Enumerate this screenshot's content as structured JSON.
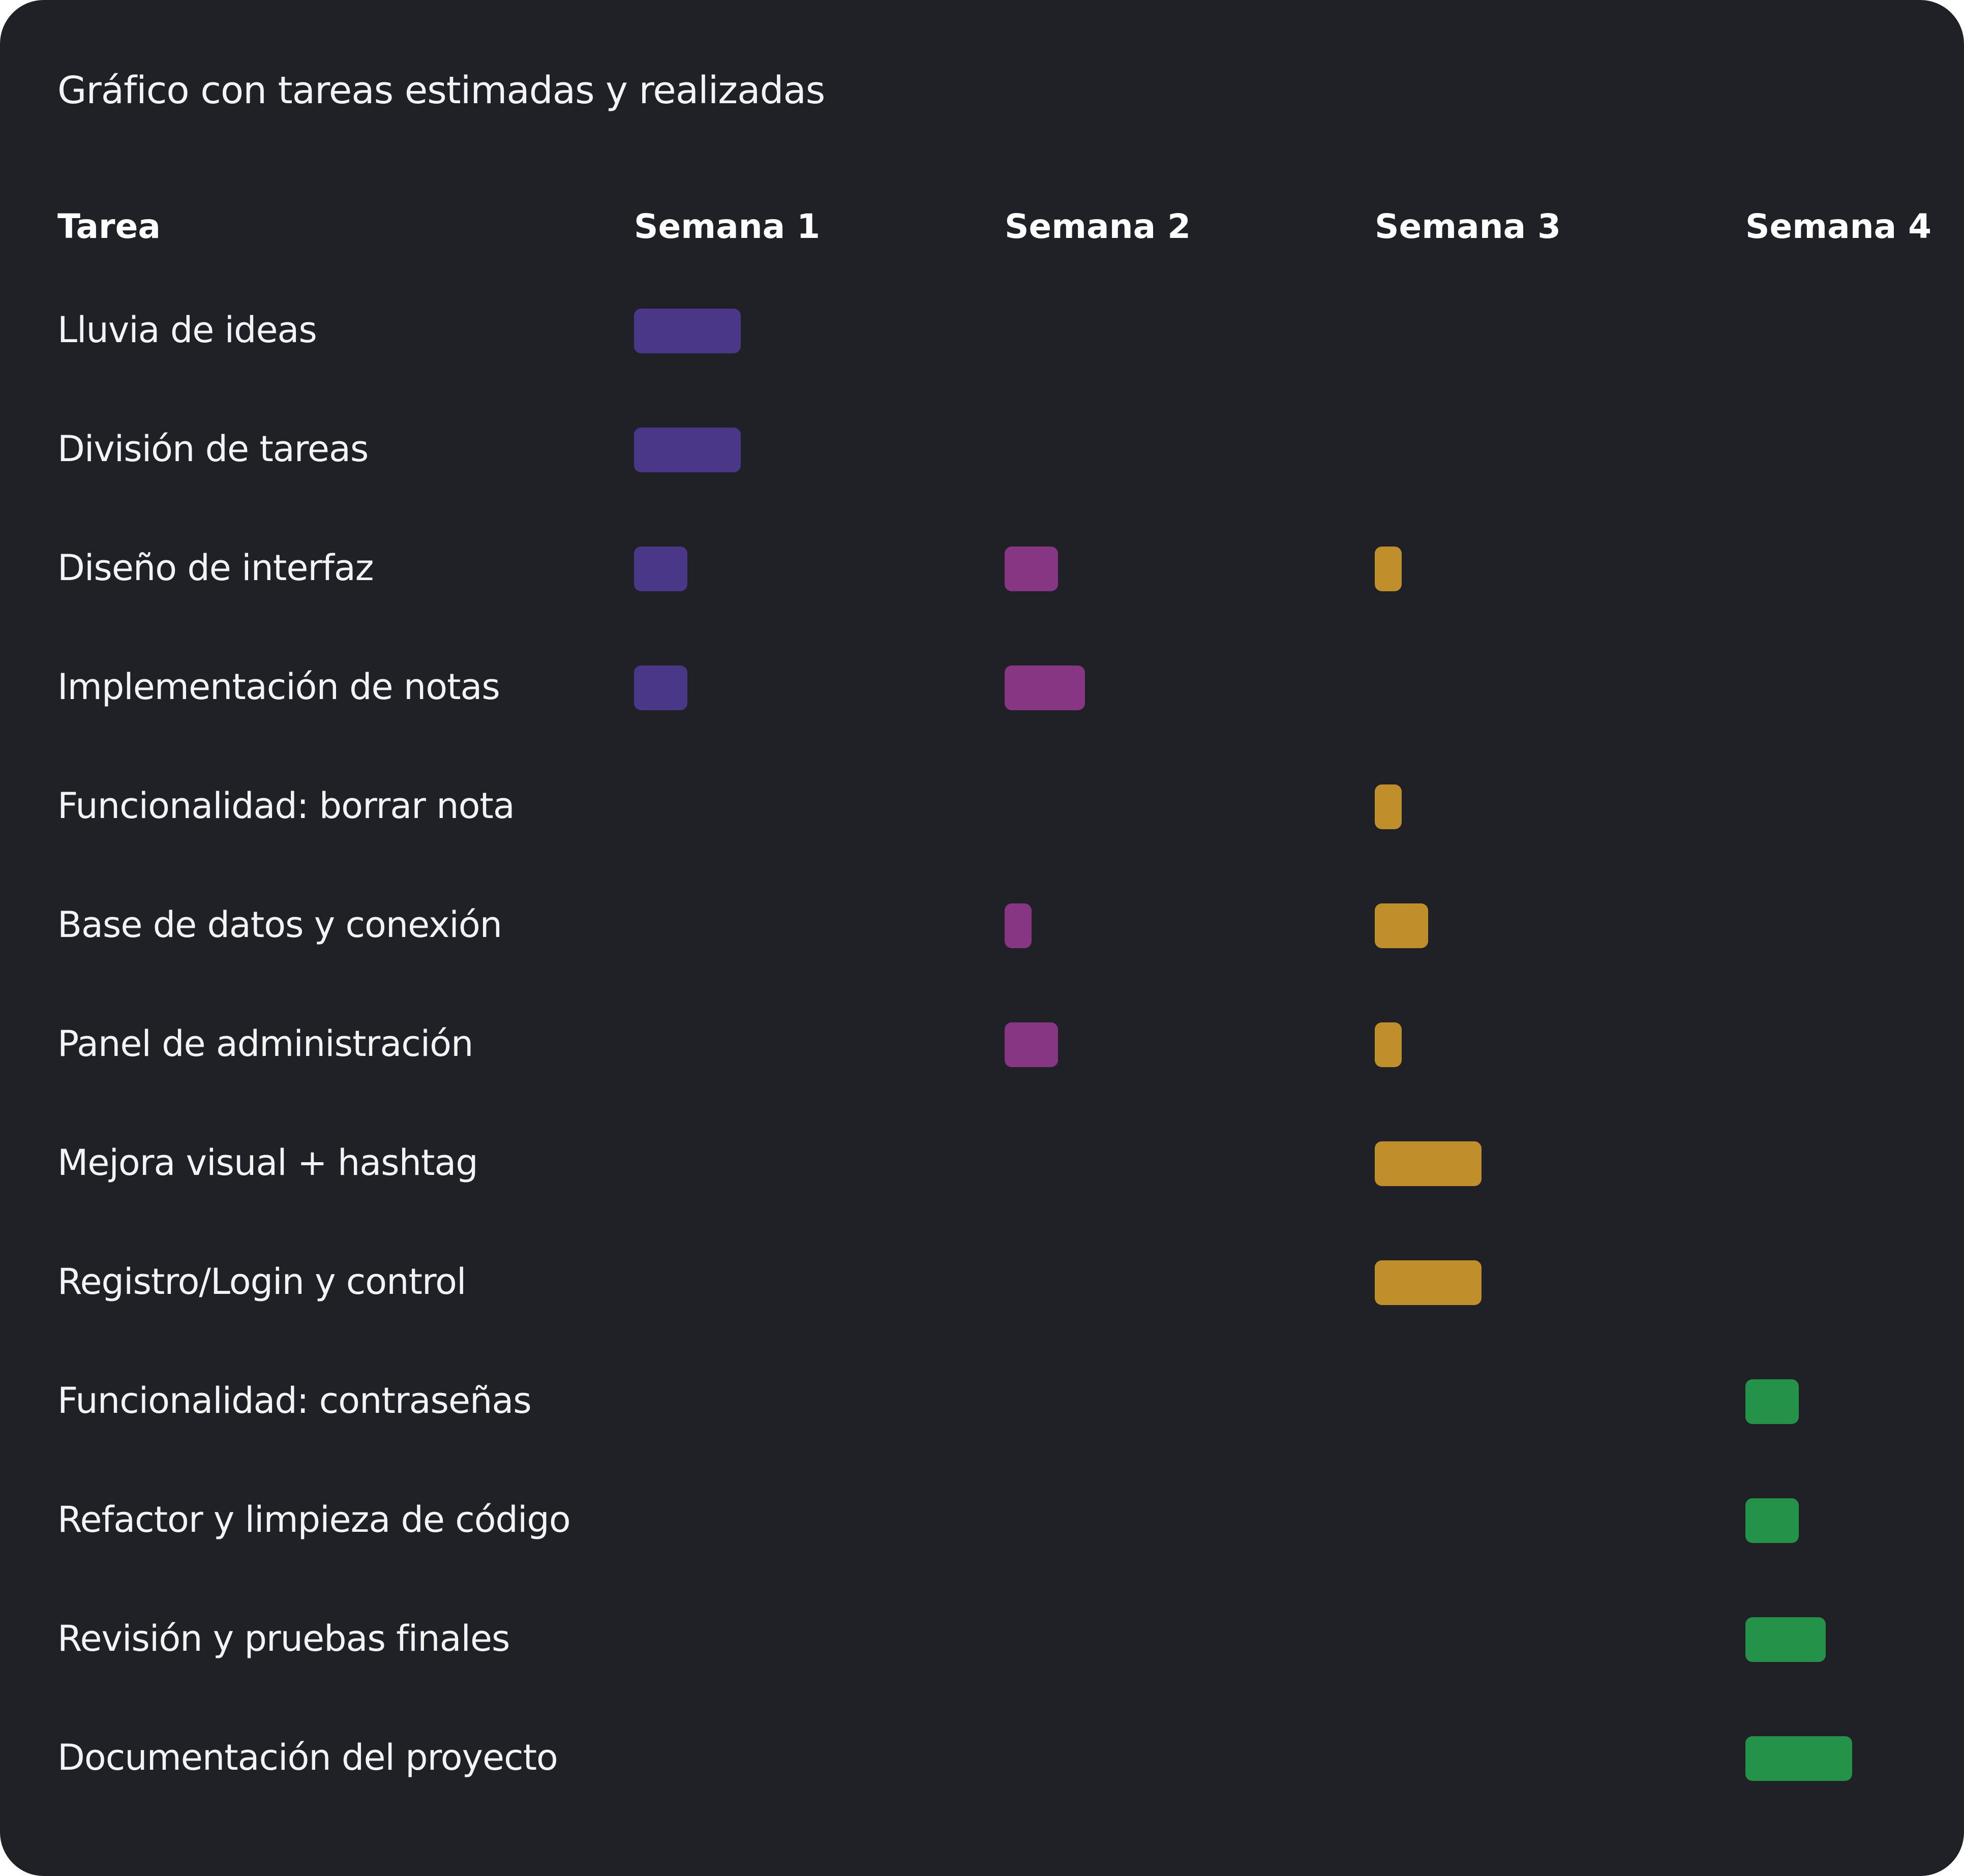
{
  "chart_data": {
    "type": "gantt",
    "title": "Gráfico con tareas estimadas y realizadas",
    "task_column_header": "Tarea",
    "weeks": [
      "Semana 1",
      "Semana 2",
      "Semana 3",
      "Semana 4"
    ],
    "week_colors": [
      "#4a3788",
      "#873684",
      "#c08e2b",
      "#25924a"
    ],
    "tasks": [
      {
        "label": "Lluvia de ideas",
        "values": [
          1.0,
          0,
          0,
          0
        ]
      },
      {
        "label": "División de tareas",
        "values": [
          1.0,
          0,
          0,
          0
        ]
      },
      {
        "label": "Diseño de interfaz",
        "values": [
          0.5,
          0.5,
          0.25,
          0
        ]
      },
      {
        "label": "Implementación de notas",
        "values": [
          0.5,
          0.75,
          0,
          0
        ]
      },
      {
        "label": "Funcionalidad: borrar nota",
        "values": [
          0,
          0,
          0.25,
          0
        ]
      },
      {
        "label": "Base de datos y conexión",
        "values": [
          0,
          0.25,
          0.5,
          0
        ]
      },
      {
        "label": "Panel de administración",
        "values": [
          0,
          0.5,
          0.25,
          0
        ]
      },
      {
        "label": "Mejora visual + hashtag",
        "values": [
          0,
          0,
          1.0,
          0
        ]
      },
      {
        "label": "Registro/Login y control",
        "values": [
          0,
          0,
          1.0,
          0
        ]
      },
      {
        "label": "Funcionalidad: contraseñas",
        "values": [
          0,
          0,
          0,
          0.5
        ]
      },
      {
        "label": "Refactor y limpieza de código",
        "values": [
          0,
          0,
          0,
          0.5
        ]
      },
      {
        "label": "Revisión y pruebas finales",
        "values": [
          0,
          0,
          0,
          0.75
        ]
      },
      {
        "label": "Documentación del proyecto",
        "values": [
          0,
          0,
          0,
          1.0
        ]
      }
    ]
  }
}
